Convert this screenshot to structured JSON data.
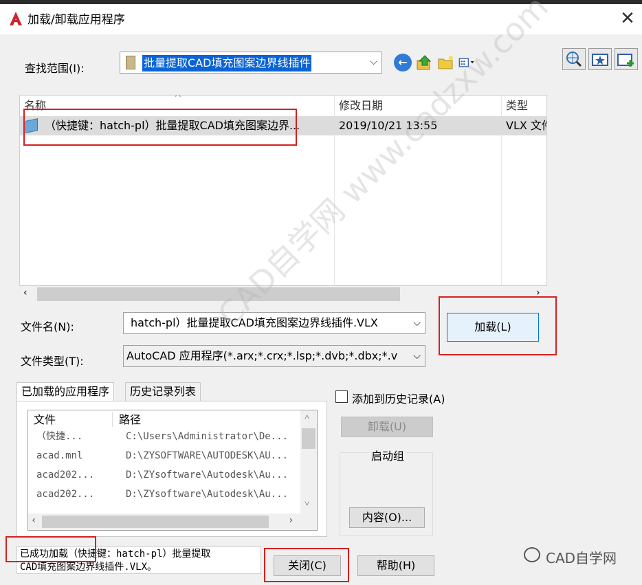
{
  "window": {
    "title": "加载/卸载应用程序",
    "close": "✕"
  },
  "look_in": {
    "label": "查找范围(I):",
    "value": "批量提取CAD填充图案边界线插件"
  },
  "file_list": {
    "columns": {
      "name": "名称",
      "modified": "修改日期",
      "type": "类型"
    },
    "rows": [
      {
        "name": "（快捷键：hatch-pl）批量提取CAD填充图案边界...",
        "modified": "2019/10/21 13:55",
        "type": "VLX 文件"
      }
    ]
  },
  "file_name": {
    "label": "文件名(N):",
    "value": "hatch-pl）批量提取CAD填充图案边界线插件.VLX"
  },
  "file_type": {
    "label": "文件类型(T):",
    "value": "AutoCAD 应用程序(*.arx;*.crx;*.lsp;*.dvb;*.dbx;*.v"
  },
  "buttons": {
    "load": "加载(L)",
    "unload": "卸载(U)",
    "contents": "内容(O)...",
    "close": "关闭(C)",
    "help": "帮助(H)"
  },
  "tabs": {
    "loaded": "已加载的应用程序",
    "history": "历史记录列表"
  },
  "app_list": {
    "columns": {
      "file": "文件",
      "path": "路径"
    },
    "rows": [
      {
        "file": "（快捷...",
        "path": "C:\\Users\\Administrator\\De..."
      },
      {
        "file": "acad.mnl",
        "path": "D:\\ZYSOFTWARE\\AUTODESK\\AU..."
      },
      {
        "file": "acad202...",
        "path": "D:\\ZYsoftware\\Autodesk\\Au..."
      },
      {
        "file": "acad202...",
        "path": "D:\\ZYsoftware\\Autodesk\\Au..."
      }
    ]
  },
  "add_to_history": "添加到历史记录(A)",
  "startup_group": "启动组",
  "status": {
    "line1": "已成功加载（快捷键：hatch-pl）批量提取",
    "line2": "CAD填充图案边界线插件.VLX。"
  },
  "watermark": {
    "brand": "CAD自学网",
    "diagonal": "CAD自学网 www.cadzxw.com"
  },
  "colors": {
    "selection": "#0a64d6",
    "highlight_box": "#d42020",
    "primary_border": "#0078d7"
  }
}
